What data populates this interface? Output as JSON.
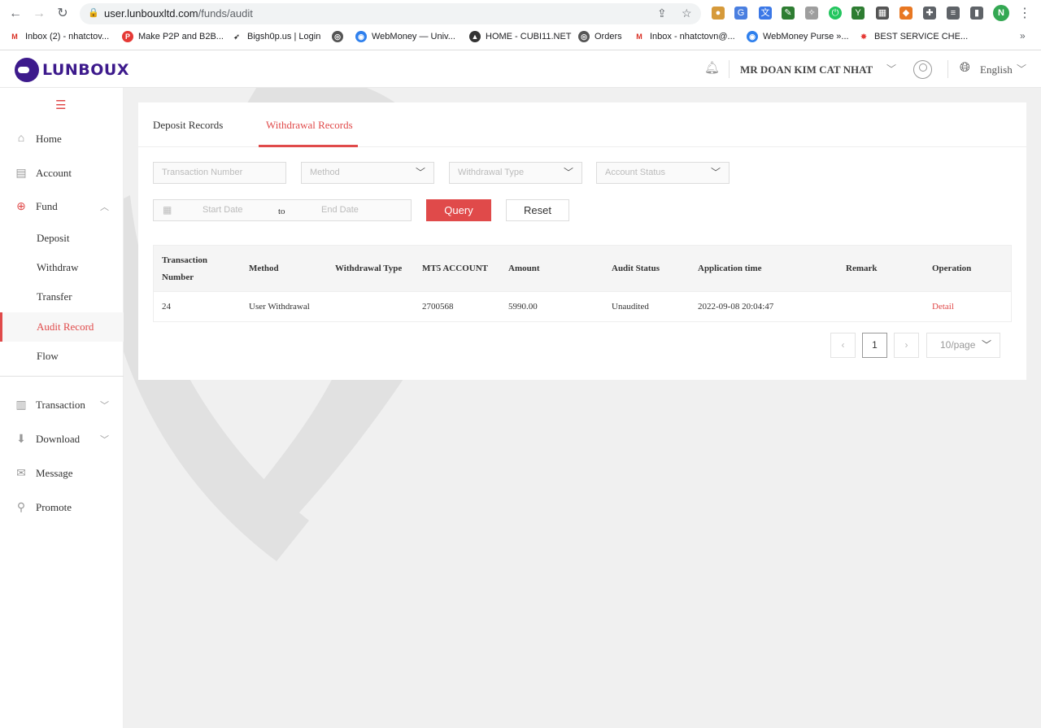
{
  "browser": {
    "url_host": "user.lunbouxltd.com",
    "url_path": "/funds/audit",
    "profile_initial": "N",
    "bookmarks": [
      {
        "label": "Inbox (2) - nhatctov...",
        "icon": "gmail-icon",
        "color": "#d93025"
      },
      {
        "label": "Make P2P and B2B...",
        "icon": "pm-icon",
        "color": "#e53935"
      },
      {
        "label": "Bigsh0p.us | Login",
        "icon": "rocket-icon",
        "color": "#333333"
      },
      {
        "label": "",
        "icon": "globe-icon",
        "color": "#555555"
      },
      {
        "label": "WebMoney — Univ...",
        "icon": "webmoney-icon",
        "color": "#2f80ed"
      },
      {
        "label": "HOME - CUBI11.NET",
        "icon": "cubi-icon",
        "color": "#333333"
      },
      {
        "label": "Orders",
        "icon": "globe-icon",
        "color": "#555555"
      },
      {
        "label": "Inbox - nhatctovn@...",
        "icon": "gmail-icon",
        "color": "#d93025"
      },
      {
        "label": "WebMoney Purse »...",
        "icon": "webmoney-icon",
        "color": "#2f80ed"
      },
      {
        "label": "BEST SERVICE CHE...",
        "icon": "star-burst-icon",
        "color": "#e53935"
      }
    ],
    "bookmarks_more": "»"
  },
  "header": {
    "logo_text": "LUNBOUX",
    "user_name": "MR DOAN KIM CAT NHAT",
    "language": "English"
  },
  "sidebar": {
    "items": [
      {
        "label": "Home",
        "icon": "home-icon"
      },
      {
        "label": "Account",
        "icon": "account-icon"
      },
      {
        "label": "Fund",
        "icon": "fund-icon"
      },
      {
        "label": "Transaction",
        "icon": "barcode-icon"
      },
      {
        "label": "Download",
        "icon": "download-icon"
      },
      {
        "label": "Message",
        "icon": "mail-icon"
      },
      {
        "label": "Promote",
        "icon": "paperclip-icon"
      }
    ],
    "fund_sub": [
      "Deposit",
      "Withdraw",
      "Transfer",
      "Audit Record",
      "Flow"
    ],
    "active_sub": "Audit Record"
  },
  "tabs": [
    "Deposit Records",
    "Withdrawal Records"
  ],
  "active_tab": "Withdrawal Records",
  "filters": {
    "transaction_number_placeholder": "Transaction Number",
    "method_placeholder": "Method",
    "withdrawal_type_placeholder": "Withdrawal Type",
    "account_status_placeholder": "Account Status",
    "start_date_placeholder": "Start Date",
    "to_label": "to",
    "end_date_placeholder": "End Date",
    "query_label": "Query",
    "reset_label": "Reset"
  },
  "table": {
    "columns": [
      "Transaction Number",
      "Method",
      "Withdrawal Type",
      "MT5 ACCOUNT",
      "Amount",
      "Audit Status",
      "Application time",
      "Remark",
      "Operation"
    ],
    "rows": [
      [
        "24",
        "User Withdrawal",
        "",
        "2700568",
        "5990.00",
        "Unaudited",
        "2022-09-08 20:04:47",
        "",
        "Detail"
      ]
    ]
  },
  "pagination": {
    "prev": "‹",
    "current_page": "1",
    "next": "›",
    "page_size": "10/page"
  },
  "colors": {
    "accent": "#e04a4a",
    "brand": "#3d1a8c"
  }
}
